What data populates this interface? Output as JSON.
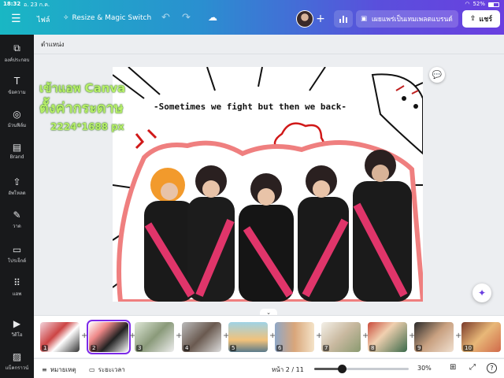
{
  "status": {
    "time": "18:32",
    "date": "อ. 23 ก.ค.",
    "battery": "52%",
    "battery_level": 0.52
  },
  "toolbar": {
    "file": "ไฟล์",
    "resize": "Resize & Magic Switch",
    "publish": "เผยแพร่เป็นเทมเพลตแบรนด์",
    "share": "แชร์"
  },
  "sidebar": {
    "items": [
      {
        "label": "องค์ประกอบ",
        "icon": "elements-icon"
      },
      {
        "label": "ข้อความ",
        "icon": "text-icon"
      },
      {
        "label": "ม้วนฟิล์ม",
        "icon": "camera-roll-icon"
      },
      {
        "label": "Brand",
        "icon": "brand-icon"
      },
      {
        "label": "อัพโหลด",
        "icon": "upload-icon"
      },
      {
        "label": "วาด",
        "icon": "draw-icon"
      },
      {
        "label": "โปรเจ็กต์",
        "icon": "projects-icon"
      },
      {
        "label": "แอพ",
        "icon": "apps-icon"
      },
      {
        "label": "วิดีโอ",
        "icon": "video-icon"
      },
      {
        "label": "แบ็คกราวน์",
        "icon": "background-icon"
      }
    ]
  },
  "panel": {
    "title": "ตำแหน่ง"
  },
  "design": {
    "caption": "-Sometimes we fight but then we back-",
    "overlay_line1": "เข้าแอพ Canva",
    "overlay_line2": "ตั้งค่ากระดาษ",
    "overlay_line3": "2224*1688 px"
  },
  "pages": {
    "thumbnails": [
      "1",
      "2",
      "3",
      "4",
      "5",
      "6",
      "7",
      "8",
      "9",
      "10"
    ],
    "selected": "2"
  },
  "bottombar": {
    "notes": "หมายเหตุ",
    "duration": "ระยะเวลา",
    "page_indicator": "หน้า 2 / 11",
    "zoom": "30%",
    "zoom_level": 0.3
  }
}
